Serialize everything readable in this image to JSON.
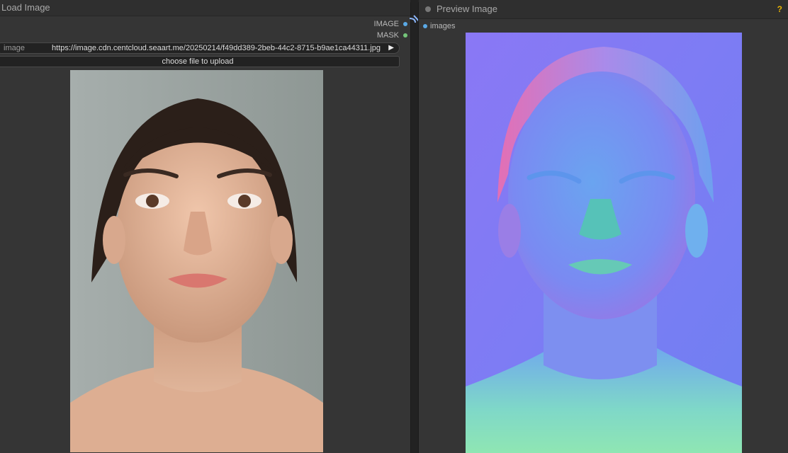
{
  "load_image": {
    "title": "Load Image",
    "outputs": [
      {
        "label": "IMAGE",
        "color": "#5aa9e6"
      },
      {
        "label": "MASK",
        "color": "#74c57a"
      }
    ],
    "image_widget": {
      "label": "image",
      "value": "https://image.cdn.centcloud.seaart.me/20250214/f49dd389-2beb-44c2-8715-b9ae1ca44311.jpg",
      "arrow_icon": "play-right-icon"
    },
    "upload_label": "choose file to upload",
    "photo": {
      "icon": "portrait-photo",
      "bg": "#9aa3a0",
      "skin": "#e3b69a",
      "hair": "#2b1f19"
    }
  },
  "preview_image": {
    "title": "Preview Image",
    "input_label": "images",
    "help_icon": "question-mark-icon",
    "photo": {
      "icon": "normal-map-portrait",
      "bg": "#7b76f3"
    }
  }
}
